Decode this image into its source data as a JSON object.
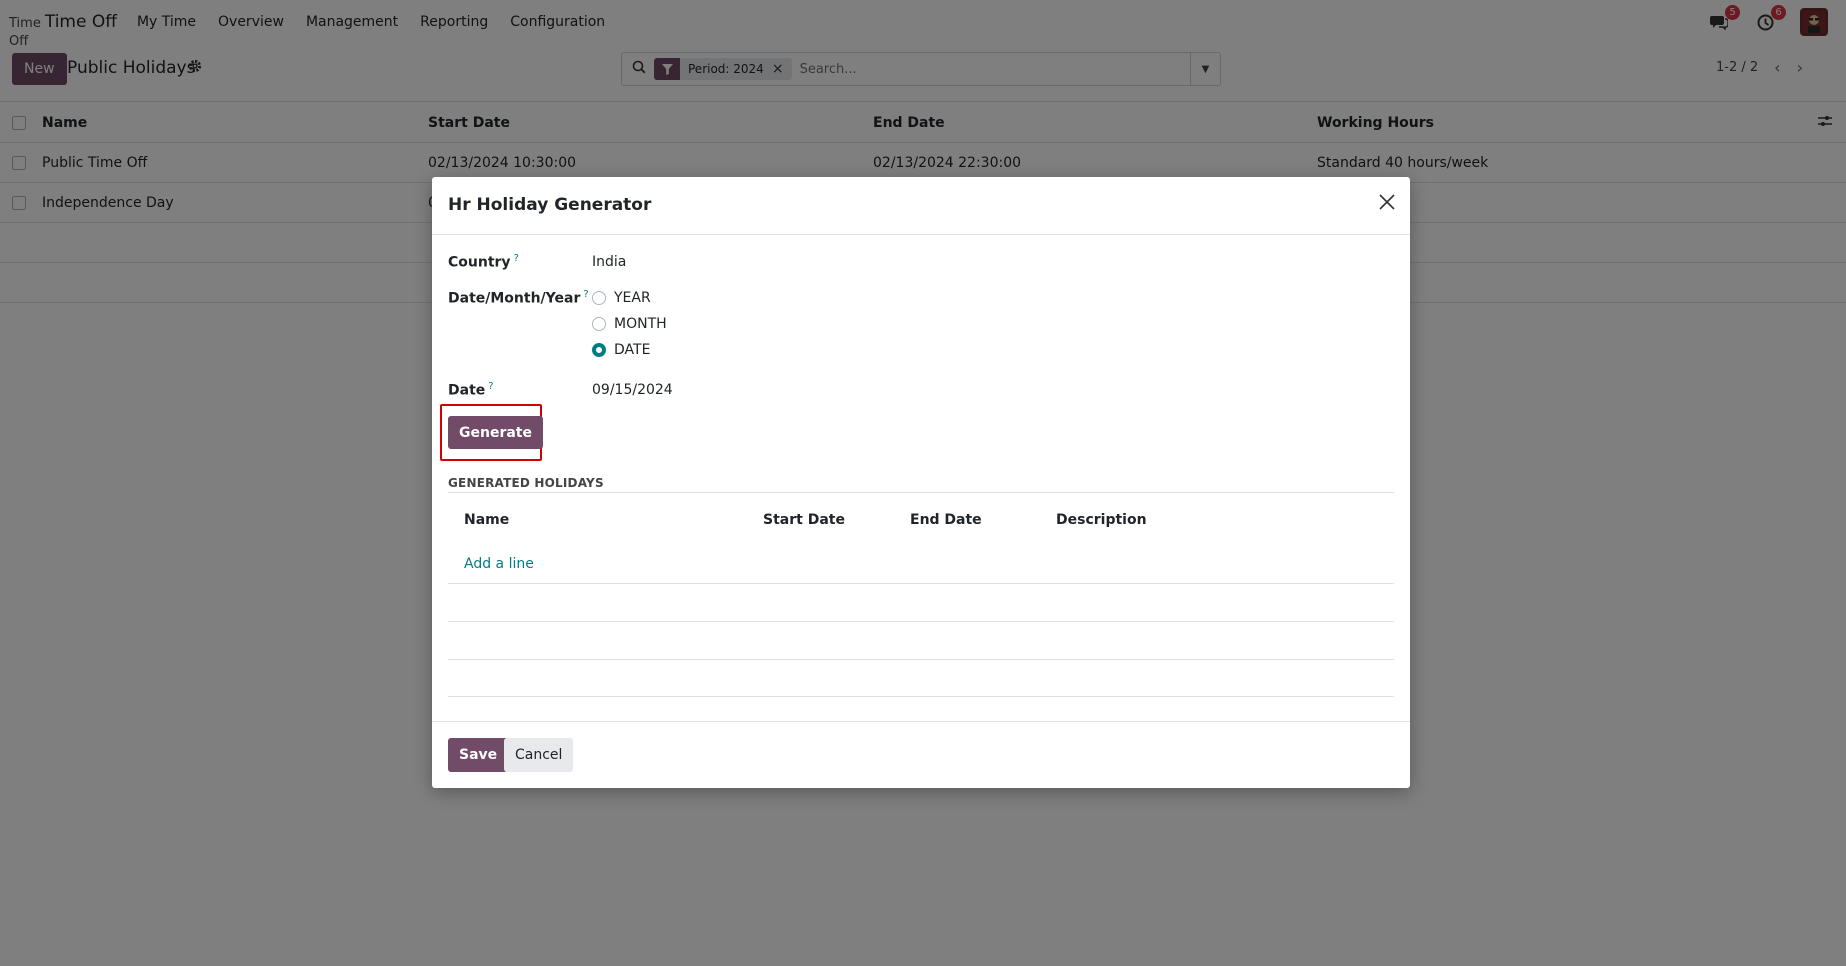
{
  "navbar": {
    "brand_small": "Time",
    "brand_wrap": "Off",
    "brand_big": "Time Off",
    "menu": [
      "My Time",
      "Overview",
      "Management",
      "Reporting",
      "Configuration"
    ],
    "messages_badge": "5",
    "activities_badge": "6"
  },
  "control": {
    "new_label": "New",
    "title": "Public Holidays",
    "facet_label": "Period: 2024",
    "search_placeholder": "Search...",
    "pager": "1-2 / 2"
  },
  "list": {
    "headers": [
      "Name",
      "Start Date",
      "End Date",
      "Working Hours"
    ],
    "rows": [
      [
        "Public Time Off",
        "02/13/2024 10:30:00",
        "02/13/2024 22:30:00",
        "Standard 40 hours/week"
      ],
      [
        "Independence Day",
        "0",
        "",
        ""
      ]
    ]
  },
  "modal": {
    "title": "Hr Holiday Generator",
    "country_label": "Country",
    "country_value": "India",
    "dmy_label": "Date/Month/Year",
    "options": [
      "YEAR",
      "MONTH",
      "DATE"
    ],
    "selected_option": "DATE",
    "date_label": "Date",
    "date_value": "09/15/2024",
    "generate_label": "Generate",
    "section_title": "GENERATED HOLIDAYS",
    "columns": [
      "Name",
      "Start Date",
      "End Date",
      "Description"
    ],
    "add_line": "Add a line",
    "save_label": "Save",
    "cancel_label": "Cancel",
    "help_mark": "?"
  },
  "colors": {
    "primary": "#714B67",
    "accent": "#017e84",
    "highlight": "#d40000"
  }
}
